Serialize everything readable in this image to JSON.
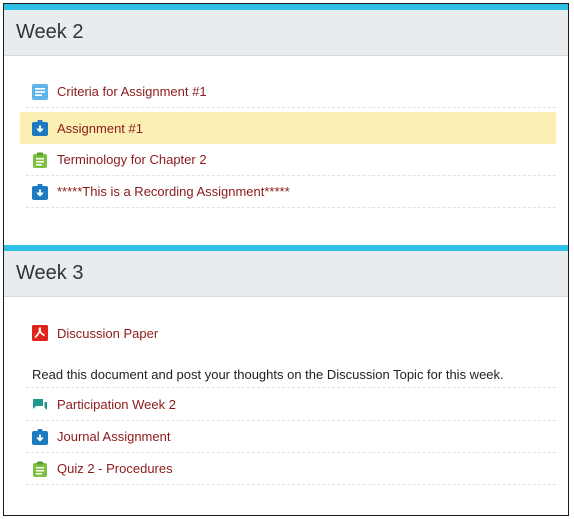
{
  "weeks": [
    {
      "title": "Week 2",
      "items": [
        {
          "label": "Criteria for Assignment #1",
          "icon": "page-icon"
        },
        {
          "label": "Assignment #1",
          "icon": "assignment-download-icon",
          "highlighted": true
        },
        {
          "label": "Terminology for Chapter 2",
          "icon": "clipboard-icon"
        },
        {
          "label": "*****This is a Recording Assignment*****",
          "icon": "assignment-download-icon"
        }
      ]
    },
    {
      "title": "Week 3",
      "items": [
        {
          "label": "Discussion Paper",
          "icon": "pdf-icon",
          "description": "Read this document and post your thoughts on the Discussion Topic for this week."
        },
        {
          "label": "Participation Week 2",
          "icon": "forum-icon"
        },
        {
          "label": "Journal Assignment",
          "icon": "assignment-download-icon"
        },
        {
          "label": "Quiz 2 - Procedures",
          "icon": "clipboard-icon"
        }
      ]
    }
  ],
  "colors": {
    "accent_bar": "#30c0e6",
    "link": "#8b1a1a",
    "highlight": "#fcefb4",
    "header_bg": "#e9ecef"
  }
}
